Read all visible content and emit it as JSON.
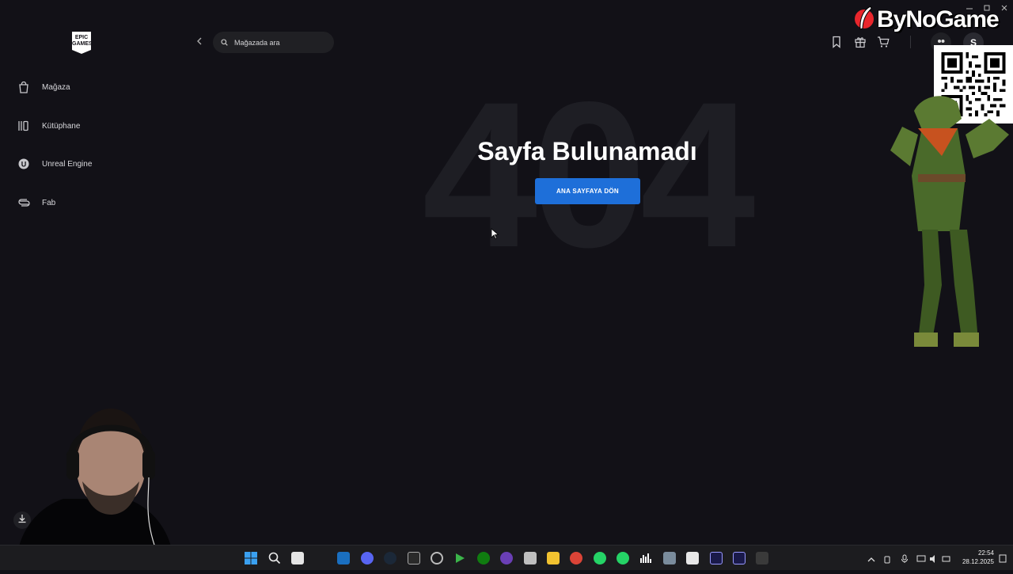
{
  "app": {
    "logo_text": "EPIC GAMES"
  },
  "sidebar": {
    "items": [
      {
        "label": "Mağaza",
        "icon": "bag-icon"
      },
      {
        "label": "Kütüphane",
        "icon": "library-icon"
      },
      {
        "label": "Unreal Engine",
        "icon": "unreal-icon"
      },
      {
        "label": "Fab",
        "icon": "fab-icon"
      }
    ],
    "download_icon": "download-icon"
  },
  "topbar": {
    "search_placeholder": "Mağazada ara",
    "avatar_initial": "S"
  },
  "error_page": {
    "code": "404",
    "title": "Sayfa Bulunamadı",
    "button_label": "ANA SAYFAYA DÖN"
  },
  "overlay": {
    "brand_name": "ByNoGame"
  },
  "taskbar": {
    "time": "22:54",
    "date": "28.12.2025"
  },
  "colors": {
    "background": "#121117",
    "accent": "#1e6fd9",
    "ghost_text": "#1e1e24"
  }
}
